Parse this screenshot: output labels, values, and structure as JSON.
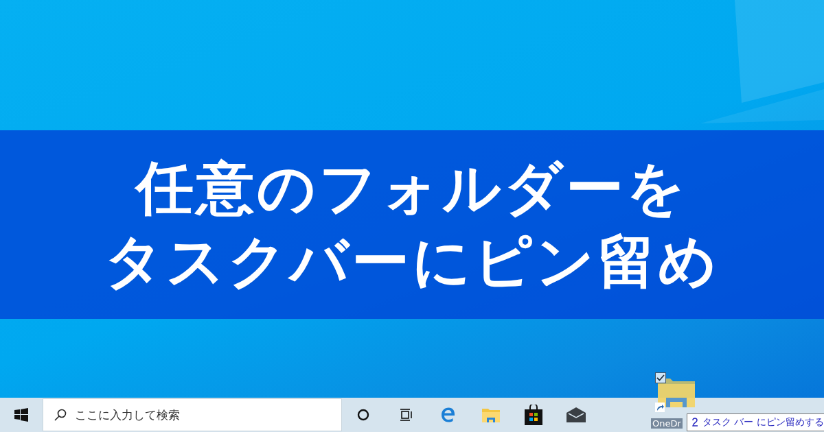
{
  "banner": {
    "lines": [
      "任意のフォルダーを",
      "タスクバーにピン留め"
    ]
  },
  "taskbar": {
    "search": {
      "placeholder": "ここに入力して検索"
    }
  },
  "drag_item": {
    "checked": true,
    "label": "OneDr",
    "tooltip": "タスク バー にピン留めする"
  }
}
